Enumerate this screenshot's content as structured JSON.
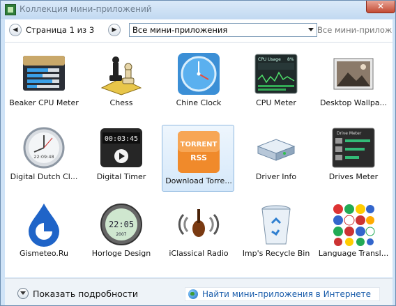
{
  "window": {
    "title": "Коллекция мини-приложений",
    "close_glyph": "✕"
  },
  "toolbar": {
    "back_glyph": "◀",
    "forward_glyph": "▶",
    "page_indicator": "Страница 1 из 3",
    "category_selected": "Все мини-приложения",
    "search_placeholder": "Все мини-приложения"
  },
  "gadgets": [
    {
      "label": "Beaker CPU Meter",
      "icon": "beaker-cpu-meter-icon"
    },
    {
      "label": "Chess",
      "icon": "chess-icon"
    },
    {
      "label": "Chine Clock",
      "icon": "chine-clock-icon"
    },
    {
      "label": "CPU Meter",
      "icon": "cpu-meter-icon",
      "texts": [
        "CPU Usage",
        "8%"
      ]
    },
    {
      "label": "Desktop Wallpa...",
      "icon": "desktop-wallpaper-icon"
    },
    {
      "label": "Digital Dutch Cl...",
      "icon": "digital-dutch-clock-icon",
      "texts": [
        "22:09:48"
      ]
    },
    {
      "label": "Digital Timer",
      "icon": "digital-timer-icon",
      "texts": [
        "00:03:45"
      ]
    },
    {
      "label": "Download Torre...",
      "icon": "download-torrent-icon",
      "selected": true,
      "texts": [
        "TORRENT",
        "RSS"
      ]
    },
    {
      "label": "Driver Info",
      "icon": "driver-info-icon"
    },
    {
      "label": "Drives Meter",
      "icon": "drives-meter-icon",
      "texts": [
        "Drive Meter"
      ]
    },
    {
      "label": "Gismeteo.Ru",
      "icon": "gismeteo-icon"
    },
    {
      "label": "Horloge Design",
      "icon": "horloge-design-icon",
      "texts": [
        "22:05",
        "2007"
      ]
    },
    {
      "label": "iClassical Radio",
      "icon": "iclassical-radio-icon"
    },
    {
      "label": "Imp's Recycle Bin",
      "icon": "recycle-bin-icon"
    },
    {
      "label": "Language Transl...",
      "icon": "language-translator-icon"
    }
  ],
  "footer": {
    "details_label": "Показать подробности",
    "online_label": "Найти мини-приложения в Интернете"
  },
  "colors": {
    "link": "#1a5dab",
    "selection_border": "#8fb8e0",
    "titlebar": "#cfe3f7"
  }
}
